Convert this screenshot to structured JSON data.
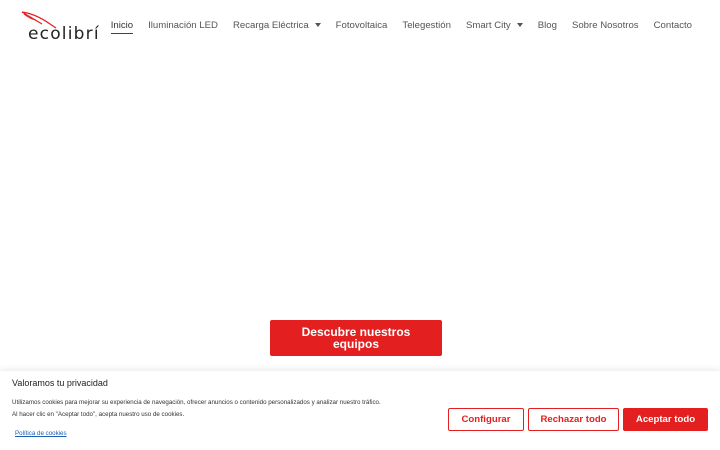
{
  "header": {
    "logo_text": "ecolibrí"
  },
  "nav": {
    "items": [
      {
        "label": "Inicio"
      },
      {
        "label": "Iluminación LED"
      },
      {
        "label": "Recarga Eléctrica"
      },
      {
        "label": "Fotovoltaica"
      },
      {
        "label": "Telegestión"
      },
      {
        "label": "Smart City"
      },
      {
        "label": "Blog"
      },
      {
        "label": "Sobre Nosotros"
      },
      {
        "label": "Contacto"
      }
    ]
  },
  "hero": {
    "cta_label": "Descubre nuestros equipos"
  },
  "cookie_banner": {
    "title": "Valoramos tu privacidad",
    "text_line1": "Utilizamos cookies para mejorar su experiencia de navegación, ofrecer anuncios o contenido personalizados y analizar nuestro tráfico.",
    "text_line2": "Al hacer clic en \"Aceptar todo\", acepta nuestro uso de cookies.",
    "policy_link": "Política de cookies",
    "configure_label": "Configurar",
    "reject_label": "Rechazar todo",
    "accept_label": "Aceptar todo"
  },
  "colors": {
    "brand_red": "#e3201f",
    "link_blue": "#1a5db3",
    "nav_underline": "#1f4f66"
  }
}
